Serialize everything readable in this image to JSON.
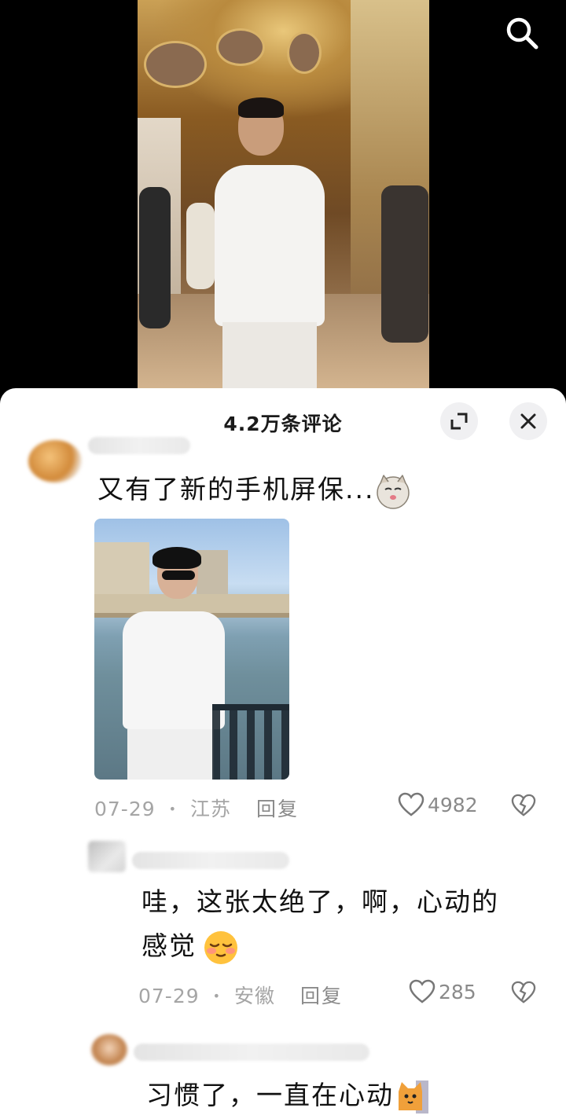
{
  "header": {
    "search_icon": "search-icon"
  },
  "sheet": {
    "title": "4.2万条评论",
    "expand_icon": "expand-icon",
    "close_icon": "close-icon"
  },
  "comments": [
    {
      "text": "又有了新的手机屏保...",
      "emoji": "cat-face-emoji",
      "has_image": true,
      "date": "07-29",
      "location": "江苏",
      "reply_label": "回复",
      "likes": "4982"
    },
    {
      "text_line1": "哇，这张太绝了，啊，心动的",
      "text_line2": "感觉",
      "emoji": "shy-smile-emoji",
      "date": "07-29",
      "location": "安徽",
      "reply_label": "回复",
      "likes": "285"
    },
    {
      "text": "习惯了，一直在心动",
      "emoji": "cat-emoji"
    }
  ],
  "meta_separator": "•"
}
